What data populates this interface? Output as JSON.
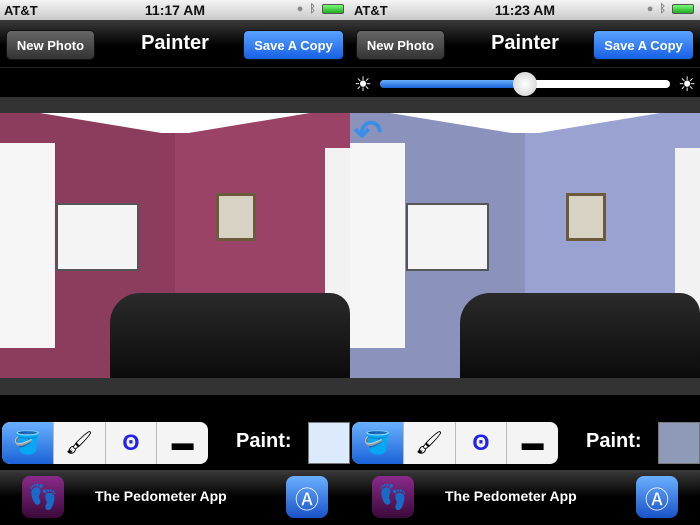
{
  "screens": [
    {
      "status": {
        "carrier": "AT&T",
        "time": "11:17 AM"
      },
      "nav": {
        "left_button": "New Photo",
        "title": "Painter",
        "right_button": "Save A Copy"
      },
      "wall_color": "#8c3d5e",
      "paint_swatch": "#dcebfb",
      "tools": [
        "paint-bucket",
        "brush",
        "lasso",
        "eraser"
      ],
      "active_tool": 0,
      "paint_label": "Paint:",
      "ad": {
        "text": "The Pedometer App"
      }
    },
    {
      "status": {
        "carrier": "AT&T",
        "time": "11:23 AM"
      },
      "nav": {
        "left_button": "New Photo",
        "title": "Painter",
        "right_button": "Save A Copy"
      },
      "brightness": 0.5,
      "wall_color": "#8b93bd",
      "paint_swatch": "#8f9ab9",
      "tools": [
        "paint-bucket",
        "brush",
        "lasso",
        "eraser"
      ],
      "active_tool": 0,
      "paint_label": "Paint:",
      "ad": {
        "text": "The Pedometer App"
      }
    }
  ]
}
